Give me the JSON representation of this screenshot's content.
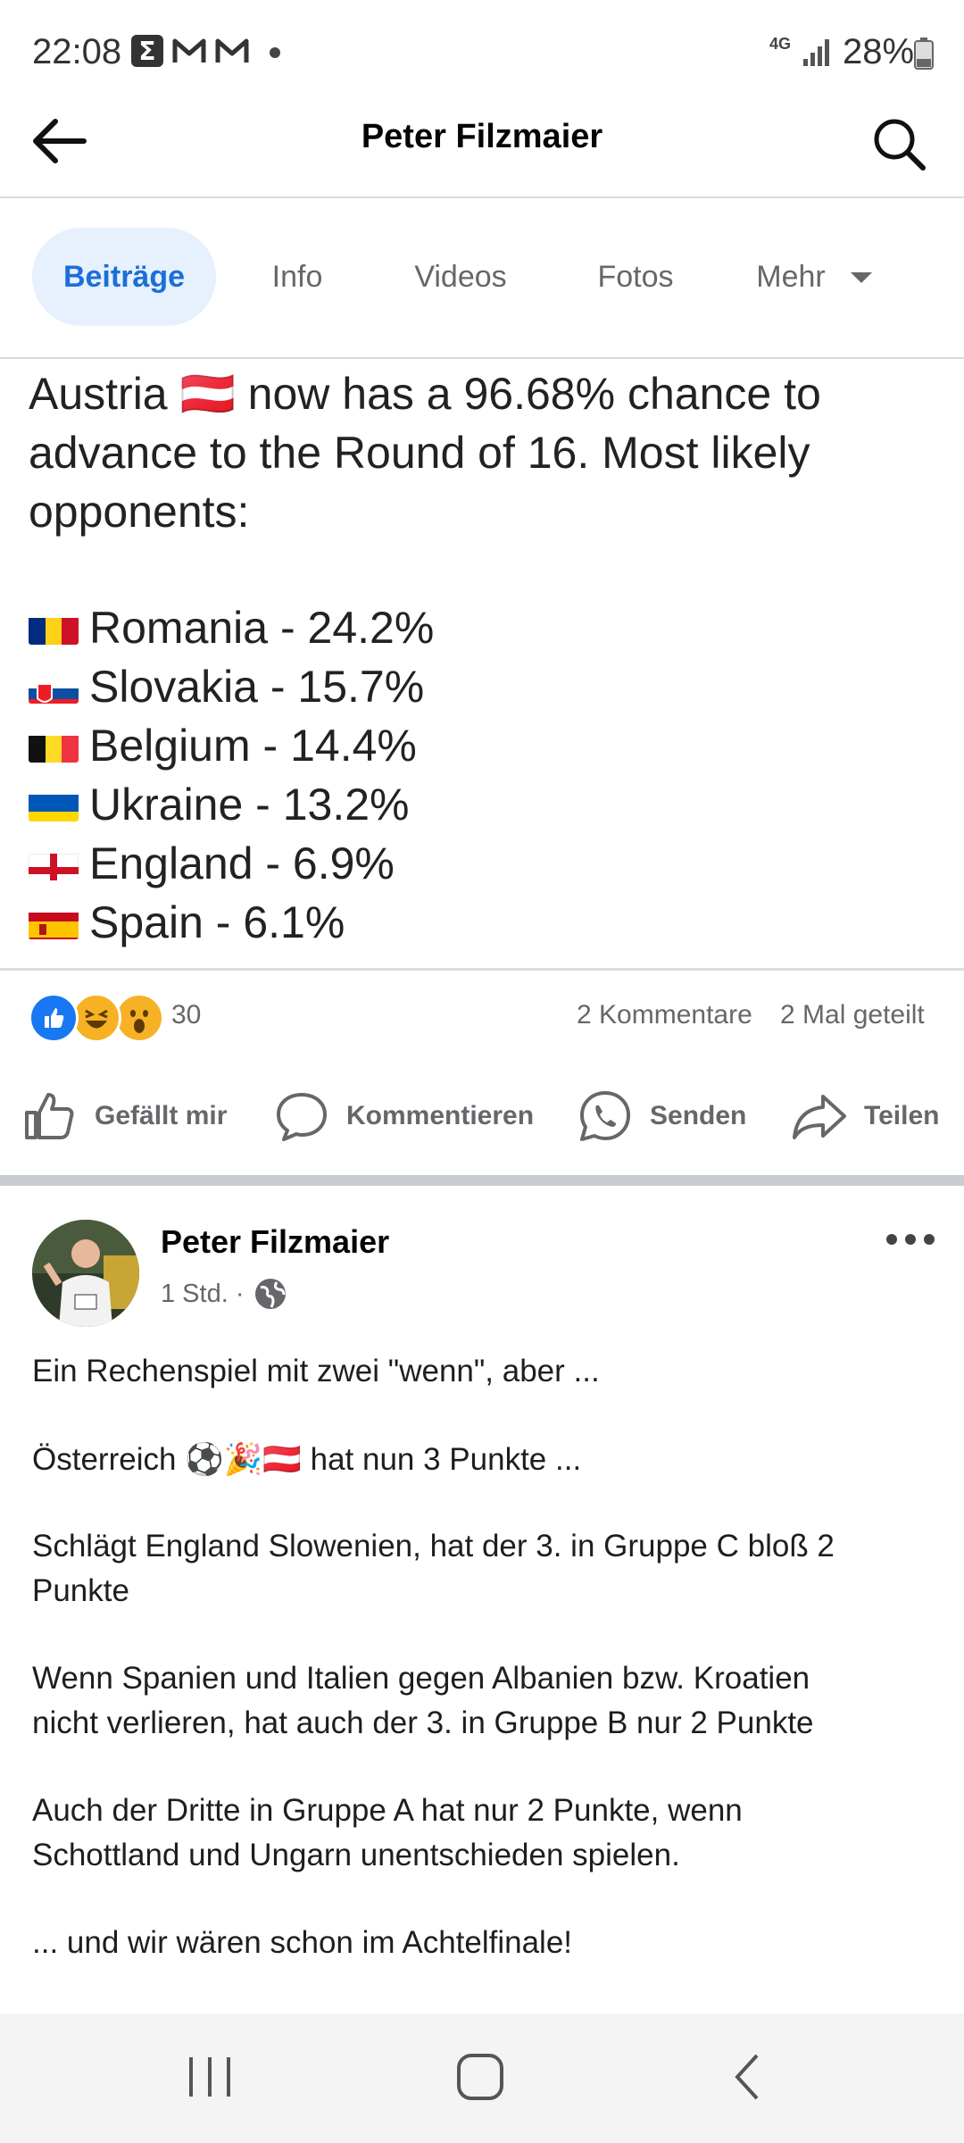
{
  "status_bar": {
    "time": "22:08",
    "network": "4G",
    "battery": "28%",
    "icons": [
      "sigma-app-icon",
      "gmail-icon",
      "gmail-icon",
      "notification-dot-icon",
      "signal-icon",
      "battery-icon"
    ]
  },
  "header": {
    "title": "Peter Filzmaier",
    "back_icon": "arrow-left-icon",
    "search_icon": "search-icon"
  },
  "tabs": [
    {
      "label": "Beiträge",
      "active": true
    },
    {
      "label": "Info",
      "active": false
    },
    {
      "label": "Videos",
      "active": false
    },
    {
      "label": "Fotos",
      "active": false
    },
    {
      "label": "Mehr",
      "active": false
    }
  ],
  "tweet": {
    "lines": [
      "Austria 🇦🇹 now has a 96.68% chance to",
      "advance to the Round of 16. Most likely",
      "opponents:"
    ],
    "opponents": [
      {
        "country": "Romania - 24.2%",
        "flag": "romania-flag"
      },
      {
        "country": "Slovakia - 15.7%",
        "flag": "slovakia-flag"
      },
      {
        "country": "Belgium - 14.4%",
        "flag": "belgium-flag"
      },
      {
        "country": "Ukraine - 13.2%",
        "flag": "ukraine-flag"
      },
      {
        "country": "England - 6.9%",
        "flag": "england-flag"
      },
      {
        "country": "Spain - 6.1%",
        "flag": "spain-flag"
      }
    ]
  },
  "reactions": {
    "count": "30",
    "comments": "2 Kommentare",
    "shares": "2 Mal geteilt",
    "icons": [
      "like-icon",
      "haha-icon",
      "wow-icon"
    ],
    "like_color": "#1877f2"
  },
  "actions": [
    {
      "label": "Gefällt mir",
      "icon": "thumbs-up-icon"
    },
    {
      "label": "Kommentieren",
      "icon": "comment-icon"
    },
    {
      "label": "Senden",
      "icon": "whatsapp-icon"
    },
    {
      "label": "Teilen",
      "icon": "share-icon"
    }
  ],
  "post": {
    "author": "Peter Filzmaier",
    "time": "1 Std. ·",
    "privacy_icon": "globe-icon",
    "more_icon": "more-dots-icon",
    "paragraphs": [
      [
        "Ein Rechenspiel mit zwei \"wenn\", aber ..."
      ],
      [
        "Österreich ⚽🎉🇦🇹 hat nun 3 Punkte ..."
      ],
      [
        "Schlägt England Slowenien, hat der 3. in Gruppe C bloß 2",
        "Punkte"
      ],
      [
        "Wenn Spanien und Italien gegen Albanien bzw. Kroatien",
        "nicht verlieren, hat auch der 3. in Gruppe B nur 2 Punkte"
      ],
      [
        "Auch der Dritte in Gruppe A hat nur 2 Punkte, wenn",
        "Schottland und Ungarn unentschieden spielen."
      ],
      [
        "... und wir wären schon im Achtelfinale!"
      ]
    ]
  },
  "nav": {
    "icons": [
      "recent-apps-icon",
      "home-icon",
      "back-icon"
    ]
  },
  "colors": {
    "accent": "#1b6fd9",
    "tab_active_bg": "#e7f0fd",
    "muted_text": "#65676b"
  }
}
